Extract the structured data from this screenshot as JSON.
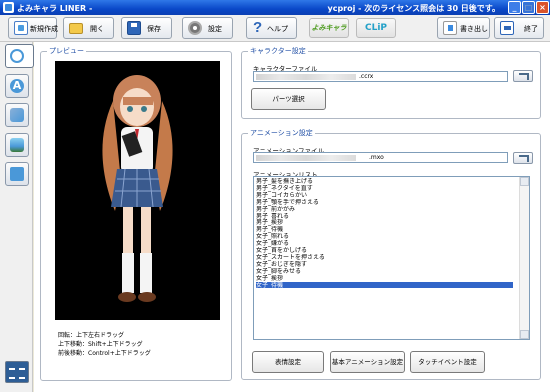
{
  "window": {
    "title": "よみキャラ LINER -",
    "title_right": "ycproj - 次のライセンス照会は 30 日後です。",
    "min_glyph": "_",
    "max_glyph": "□",
    "close_glyph": "×"
  },
  "toolbar": {
    "new_label": "新規作成",
    "open_label": "開く",
    "save_label": "保存",
    "settings_label": "設定",
    "help_label": "ヘルプ",
    "logo1_text": "よみキャラ",
    "logo2_text": "CLiP",
    "export_label": "書き出し",
    "exit_label": "終了"
  },
  "sidebar": {
    "items": [
      {
        "icon": "character-icon"
      },
      {
        "icon": "text-icon",
        "glyph": "A"
      },
      {
        "icon": "voice-icon"
      },
      {
        "icon": "background-icon"
      },
      {
        "icon": "camera-icon"
      }
    ],
    "bottom_icon": "timeline-icon"
  },
  "preview": {
    "title": "プレビュー",
    "hint_rotate": "回転：上下左右ドラッグ",
    "hint_move_vertical": "上下移動：Shift+上下ドラッグ",
    "hint_move_depth": "前後移動：Control+上下ドラッグ"
  },
  "character_settings": {
    "title": "キャラクター設定",
    "file_label": "キャラクターファイル",
    "file_ext": ".ccrx",
    "parts_button": "パーツ選択"
  },
  "animation_settings": {
    "title": "アニメーション設定",
    "file_label": "アニメーションファイル",
    "file_ext": ".mxo",
    "list_label": "アニメーションリスト",
    "items": [
      "男子_髪を撫き上げる",
      "男子_ネクタイを直す",
      "男子_コイカらかい",
      "男子_顎を手で押さえる",
      "男子_前かがみ",
      "男子_喜れる",
      "男子_挨拶",
      "男子_待機",
      "女子_照れる",
      "女子_嫌がる",
      "女子_首をかしげる",
      "女子_スカートを押さえる",
      "女子_おじぎを隠す",
      "女子_脚をみせる",
      "女子_挨拶",
      "女子_待機"
    ],
    "selected_index": 15,
    "buttons": {
      "expression": "表情設定",
      "basic_animation": "基本アニメーション設定",
      "touch_event": "タッチイベント設定"
    }
  }
}
